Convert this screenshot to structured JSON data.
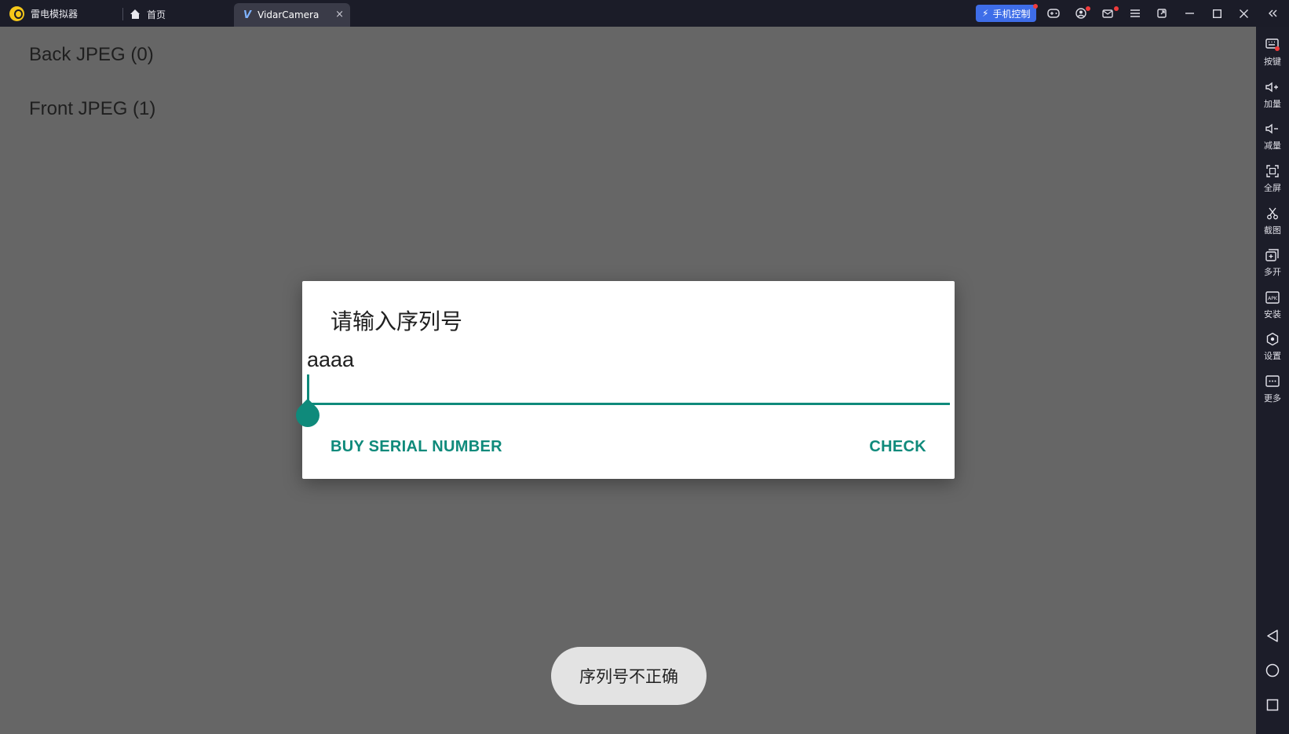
{
  "titlebar": {
    "app_name": "雷电模拟器",
    "home_tab": "首页",
    "active_tab": "VidarCamera",
    "tab_close": "×",
    "phone_control": "手机控制"
  },
  "screen": {
    "list": [
      {
        "label": "Back JPEG (0)"
      },
      {
        "label": "Front JPEG (1)"
      }
    ],
    "dialog": {
      "title": "请输入序列号",
      "input_value": "aaaa",
      "buy_button": "BUY SERIAL NUMBER",
      "check_button": "CHECK"
    },
    "toast": "序列号不正确"
  },
  "sidebar": {
    "items": [
      {
        "label": "按键",
        "icon": "keyboard-icon"
      },
      {
        "label": "加量",
        "icon": "volume-up-icon"
      },
      {
        "label": "减量",
        "icon": "volume-down-icon"
      },
      {
        "label": "全屏",
        "icon": "fullscreen-icon"
      },
      {
        "label": "截图",
        "icon": "scissors-icon"
      },
      {
        "label": "多开",
        "icon": "multi-window-icon"
      },
      {
        "label": "安装",
        "icon": "apk-install-icon"
      },
      {
        "label": "设置",
        "icon": "settings-icon"
      },
      {
        "label": "更多",
        "icon": "more-icon"
      }
    ]
  },
  "colors": {
    "accent": "#0f8a7b",
    "scrim": "#666666",
    "chrome": "#1c1d29",
    "phone_control": "#3e6de8"
  }
}
